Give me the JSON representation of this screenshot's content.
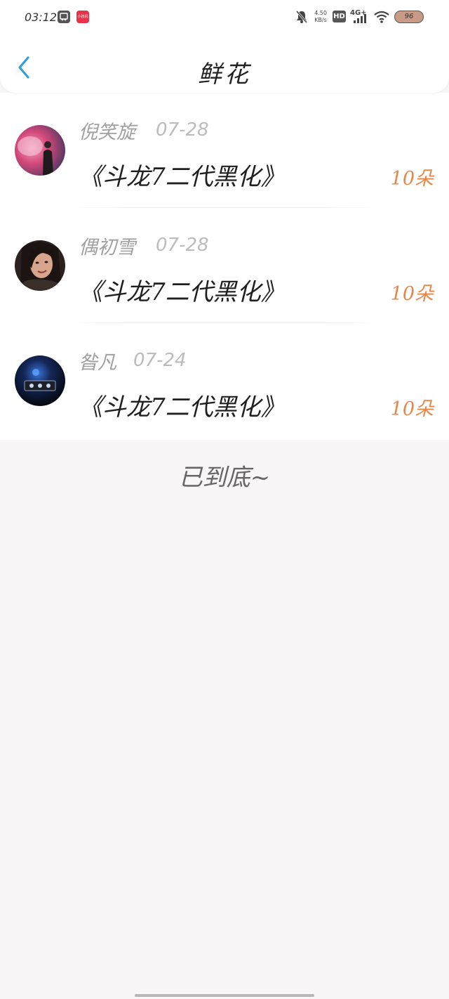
{
  "status_bar": {
    "time": "03:12",
    "app2_label": "小技机",
    "speed_value": "4.50",
    "speed_unit": "KB/s",
    "hd_label": "HD",
    "network_label": "4G+",
    "battery_level": "96"
  },
  "header": {
    "title": "鲜花"
  },
  "list": {
    "items": [
      {
        "user_name": "倪笑旋",
        "date": "07-28",
        "title": "《斗龙7二代黑化》",
        "flower_count": "10朵"
      },
      {
        "user_name": "偶初雪",
        "date": "07-28",
        "title": "《斗龙7二代黑化》",
        "flower_count": "10朵"
      },
      {
        "user_name": "昝凡",
        "date": "07-24",
        "title": "《斗龙7二代黑化》",
        "flower_count": "10朵"
      }
    ]
  },
  "footer": {
    "end_text": "已到底~"
  },
  "colors": {
    "accent_blue": "#2f9fe0",
    "flower_orange": "#e8874a",
    "background": "#f8f6f7"
  }
}
